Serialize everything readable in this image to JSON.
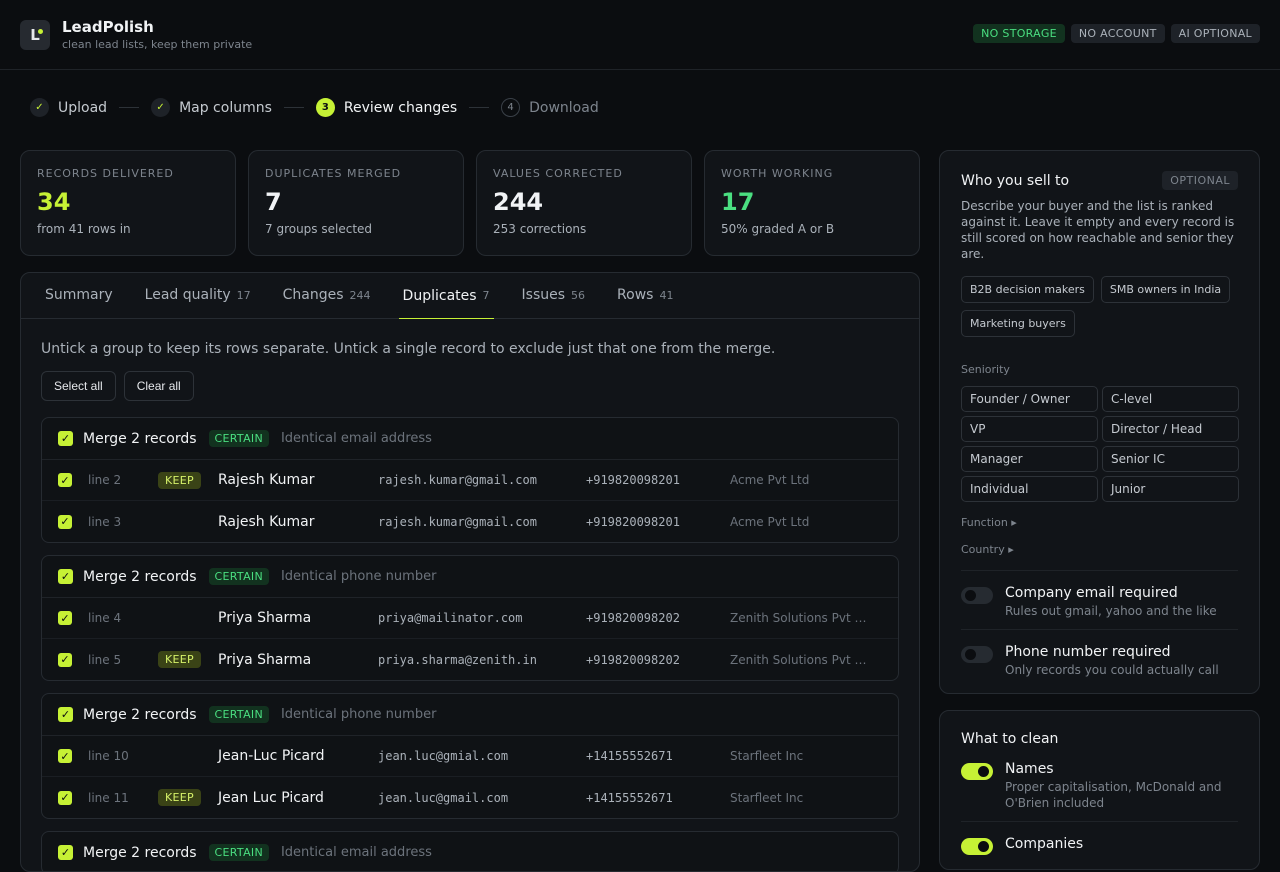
{
  "app": {
    "name": "LeadPolish",
    "tagline": "clean lead lists, keep them private",
    "logo_letter": "L"
  },
  "badges": [
    "NO STORAGE",
    "NO ACCOUNT",
    "AI OPTIONAL"
  ],
  "steps": [
    {
      "label": "Upload",
      "mark": "✓"
    },
    {
      "label": "Map columns",
      "mark": "✓"
    },
    {
      "label": "Review changes",
      "mark": "3"
    },
    {
      "label": "Download",
      "mark": "4"
    }
  ],
  "stats": [
    {
      "key": "RECORDS DELIVERED",
      "value": "34",
      "sub": "from 41 rows in"
    },
    {
      "key": "DUPLICATES MERGED",
      "value": "7",
      "sub": "7 groups selected"
    },
    {
      "key": "VALUES CORRECTED",
      "value": "244",
      "sub": "253 corrections"
    },
    {
      "key": "WORTH WORKING",
      "value": "17",
      "sub": "50% graded A or B"
    }
  ],
  "tabs": [
    {
      "label": "Summary",
      "count": ""
    },
    {
      "label": "Lead quality",
      "count": "17"
    },
    {
      "label": "Changes",
      "count": "244"
    },
    {
      "label": "Duplicates",
      "count": "7"
    },
    {
      "label": "Issues",
      "count": "56"
    },
    {
      "label": "Rows",
      "count": "41"
    }
  ],
  "duplicates": {
    "intro": "Untick a group to keep its rows separate. Untick a single record to exclude just that one from the merge.",
    "select_all": "Select all",
    "clear_all": "Clear all",
    "keep_label": "KEEP",
    "groups": [
      {
        "title": "Merge 2 records",
        "confidence": "CERTAIN",
        "reason": "Identical email address",
        "rows": [
          {
            "line": "line 2",
            "name": "Rajesh Kumar",
            "email": "rajesh.kumar@gmail.com",
            "phone": "+919820098201",
            "company": "Acme Pvt Ltd"
          },
          {
            "line": "line 3",
            "name": "Rajesh Kumar",
            "email": "rajesh.kumar@gmail.com",
            "phone": "+919820098201",
            "company": "Acme Pvt Ltd"
          }
        ]
      },
      {
        "title": "Merge 2 records",
        "confidence": "CERTAIN",
        "reason": "Identical phone number",
        "rows": [
          {
            "line": "line 4",
            "name": "Priya Sharma",
            "email": "priya@mailinator.com",
            "phone": "+919820098202",
            "company": "Zenith Solutions Pvt …"
          },
          {
            "line": "line 5",
            "name": "Priya Sharma",
            "email": "priya.sharma@zenith.in",
            "phone": "+919820098202",
            "company": "Zenith Solutions Pvt …"
          }
        ]
      },
      {
        "title": "Merge 2 records",
        "confidence": "CERTAIN",
        "reason": "Identical phone number",
        "rows": [
          {
            "line": "line 10",
            "name": "Jean-Luc Picard",
            "email": "jean.luc@gmial.com",
            "phone": "+14155552671",
            "company": "Starfleet Inc"
          },
          {
            "line": "line 11",
            "name": "Jean Luc Picard",
            "email": "jean.luc@gmail.com",
            "phone": "+14155552671",
            "company": "Starfleet Inc"
          }
        ]
      },
      {
        "title": "Merge 2 records",
        "confidence": "CERTAIN",
        "reason": "Identical email address",
        "rows": []
      }
    ]
  },
  "sell_to": {
    "title": "Who you sell to",
    "optional": "OPTIONAL",
    "desc": "Describe your buyer and the list is ranked against it. Leave it empty and every record is still scored on how reachable and senior they are.",
    "chips": [
      "B2B decision makers",
      "SMB owners in India",
      "Marketing buyers"
    ],
    "seniority_label": "Seniority",
    "seniority": [
      "Founder / Owner",
      "C-level",
      "VP",
      "Director / Head",
      "Manager",
      "Senior IC",
      "Individual",
      "Junior"
    ],
    "function": "Function ▸",
    "country": "Country ▸",
    "toggles": [
      {
        "title": "Company email required",
        "desc": "Rules out gmail, yahoo and the like"
      },
      {
        "title": "Phone number required",
        "desc": "Only records you could actually call"
      }
    ]
  },
  "clean": {
    "title": "What to clean",
    "toggles": [
      {
        "title": "Names",
        "desc": "Proper capitalisation, McDonald and O'Brien included"
      },
      {
        "title": "Companies",
        "desc": ""
      }
    ]
  },
  "colors": {
    "accent": "#c6f135",
    "green": "#4ade80",
    "bg": "#0b0d10"
  },
  "icons": {
    "check": "check-icon",
    "chevron": "chevron-right-icon"
  }
}
